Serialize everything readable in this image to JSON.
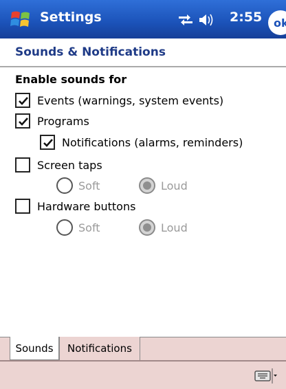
{
  "titlebar": {
    "app_title": "Settings",
    "clock": "2:55",
    "ok_label": "ok"
  },
  "page": {
    "title": "Sounds & Notifications",
    "section_title": "Enable sounds for"
  },
  "options": [
    {
      "label": "Events (warnings, system events)",
      "checked": true
    },
    {
      "label": "Programs",
      "checked": true
    },
    {
      "label": "Notifications (alarms, reminders)",
      "checked": true
    },
    {
      "label": "Screen taps",
      "checked": false
    },
    {
      "label": "Hardware buttons",
      "checked": false
    }
  ],
  "screen_taps_radios": [
    {
      "label": "Soft",
      "selected": false
    },
    {
      "label": "Loud",
      "selected": true
    }
  ],
  "hardware_buttons_radios": [
    {
      "label": "Soft",
      "selected": false
    },
    {
      "label": "Loud",
      "selected": true
    }
  ],
  "tabs": [
    {
      "label": "Sounds",
      "active": true
    },
    {
      "label": "Notifications",
      "active": false
    }
  ],
  "colors": {
    "titlebar": "#1b52b8",
    "page_title": "#1f3b87",
    "tabbar": "#ecd4d2"
  }
}
